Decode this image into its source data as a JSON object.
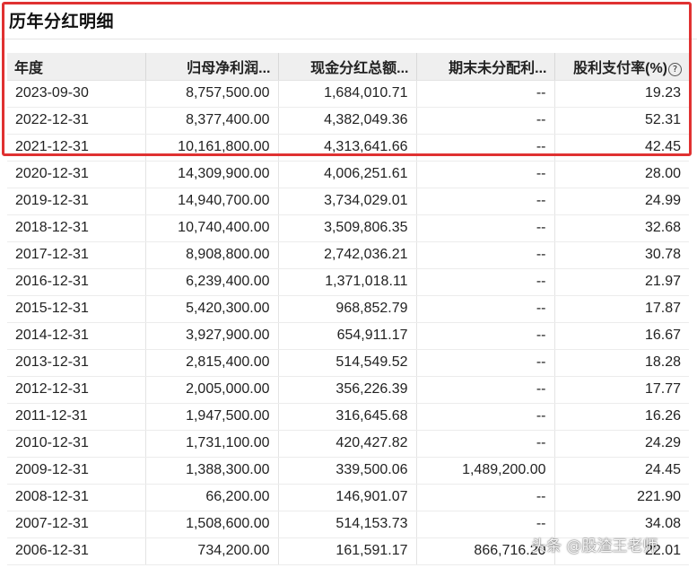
{
  "title": "历年分红明细",
  "columns": [
    "年度",
    "归母净利润...",
    "现金分红总额...",
    "期末未分配利...",
    "股利支付率(%)"
  ],
  "help_glyph": "?",
  "rows": [
    {
      "year": "2023-09-30",
      "net_profit": "8,757,500.00",
      "cash_dividend": "1,684,010.71",
      "undistributed": "--",
      "payout_ratio": "19.23"
    },
    {
      "year": "2022-12-31",
      "net_profit": "8,377,400.00",
      "cash_dividend": "4,382,049.36",
      "undistributed": "--",
      "payout_ratio": "52.31"
    },
    {
      "year": "2021-12-31",
      "net_profit": "10,161,800.00",
      "cash_dividend": "4,313,641.66",
      "undistributed": "--",
      "payout_ratio": "42.45"
    },
    {
      "year": "2020-12-31",
      "net_profit": "14,309,900.00",
      "cash_dividend": "4,006,251.61",
      "undistributed": "--",
      "payout_ratio": "28.00"
    },
    {
      "year": "2019-12-31",
      "net_profit": "14,940,700.00",
      "cash_dividend": "3,734,029.01",
      "undistributed": "--",
      "payout_ratio": "24.99"
    },
    {
      "year": "2018-12-31",
      "net_profit": "10,740,400.00",
      "cash_dividend": "3,509,806.35",
      "undistributed": "--",
      "payout_ratio": "32.68"
    },
    {
      "year": "2017-12-31",
      "net_profit": "8,908,800.00",
      "cash_dividend": "2,742,036.21",
      "undistributed": "--",
      "payout_ratio": "30.78"
    },
    {
      "year": "2016-12-31",
      "net_profit": "6,239,400.00",
      "cash_dividend": "1,371,018.11",
      "undistributed": "--",
      "payout_ratio": "21.97"
    },
    {
      "year": "2015-12-31",
      "net_profit": "5,420,300.00",
      "cash_dividend": "968,852.79",
      "undistributed": "--",
      "payout_ratio": "17.87"
    },
    {
      "year": "2014-12-31",
      "net_profit": "3,927,900.00",
      "cash_dividend": "654,911.17",
      "undistributed": "--",
      "payout_ratio": "16.67"
    },
    {
      "year": "2013-12-31",
      "net_profit": "2,815,400.00",
      "cash_dividend": "514,549.52",
      "undistributed": "--",
      "payout_ratio": "18.28"
    },
    {
      "year": "2012-12-31",
      "net_profit": "2,005,000.00",
      "cash_dividend": "356,226.39",
      "undistributed": "--",
      "payout_ratio": "17.77"
    },
    {
      "year": "2011-12-31",
      "net_profit": "1,947,500.00",
      "cash_dividend": "316,645.68",
      "undistributed": "--",
      "payout_ratio": "16.26"
    },
    {
      "year": "2010-12-31",
      "net_profit": "1,731,100.00",
      "cash_dividend": "420,427.82",
      "undistributed": "--",
      "payout_ratio": "24.29"
    },
    {
      "year": "2009-12-31",
      "net_profit": "1,388,300.00",
      "cash_dividend": "339,500.06",
      "undistributed": "1,489,200.00",
      "payout_ratio": "24.45"
    },
    {
      "year": "2008-12-31",
      "net_profit": "66,200.00",
      "cash_dividend": "146,901.07",
      "undistributed": "--",
      "payout_ratio": "221.90"
    },
    {
      "year": "2007-12-31",
      "net_profit": "1,508,600.00",
      "cash_dividend": "514,153.73",
      "undistributed": "--",
      "payout_ratio": "34.08"
    },
    {
      "year": "2006-12-31",
      "net_profit": "734,200.00",
      "cash_dividend": "161,591.17",
      "undistributed": "866,716.20",
      "payout_ratio": "22.01"
    }
  ],
  "watermark": "头条 @股渣王老师",
  "colors": {
    "highlight": "#e03131",
    "header_bg": "#efefef"
  }
}
